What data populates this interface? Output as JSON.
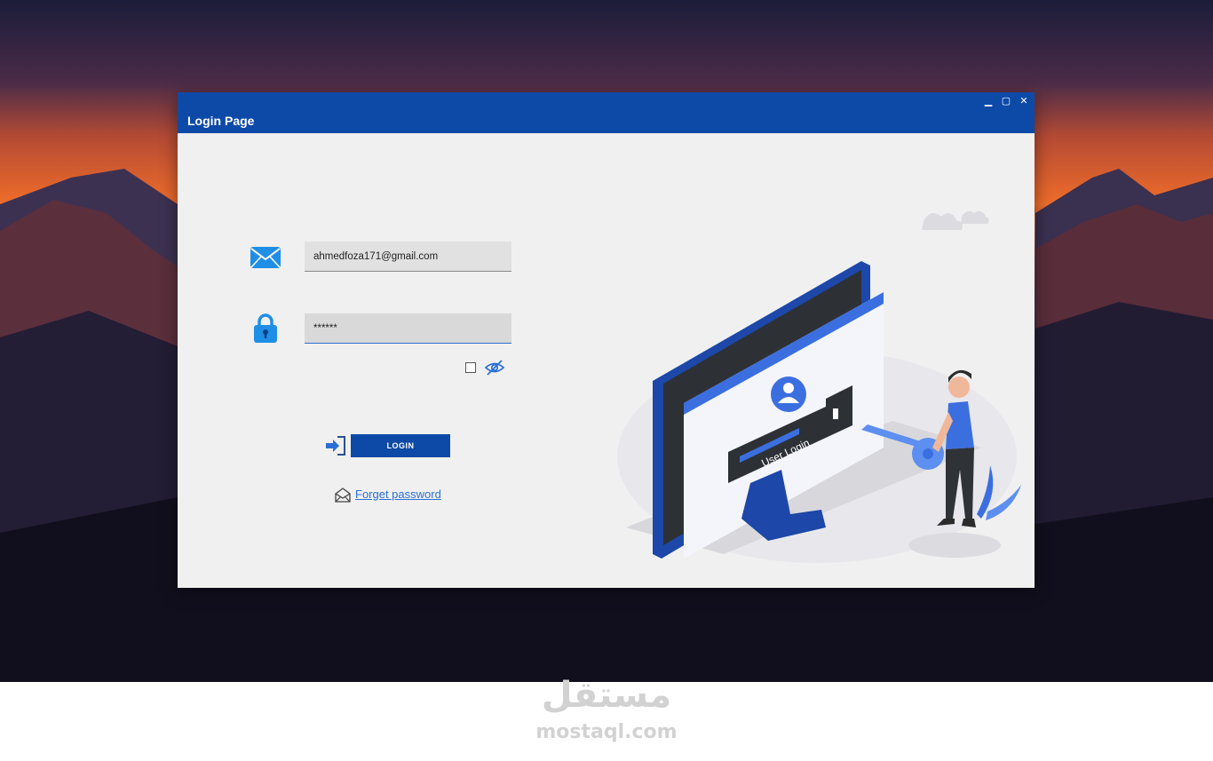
{
  "window": {
    "title": "Login Page",
    "controls": {
      "minimize": "▁",
      "maximize": "▢",
      "close": "✕"
    }
  },
  "form": {
    "email_value": "ahmedfoza171@gmail.com",
    "password_value": "******",
    "show_password_checked": false,
    "login_label": "LOGIN",
    "forget_label": "Forget password"
  },
  "illustration": {
    "screen_label": "User Login"
  },
  "icons": {
    "email": "envelope-icon",
    "password": "padlock-icon",
    "toggle_visibility": "eye-slash-icon",
    "login": "sign-in-arrow-icon",
    "forget": "open-envelope-icon"
  },
  "colors": {
    "accent": "#0d4aa8",
    "link": "#2b6fd6",
    "illustration_blue": "#3b6fe0"
  },
  "watermark": {
    "arabic": "مستقل",
    "latin": "mostaql.com"
  }
}
